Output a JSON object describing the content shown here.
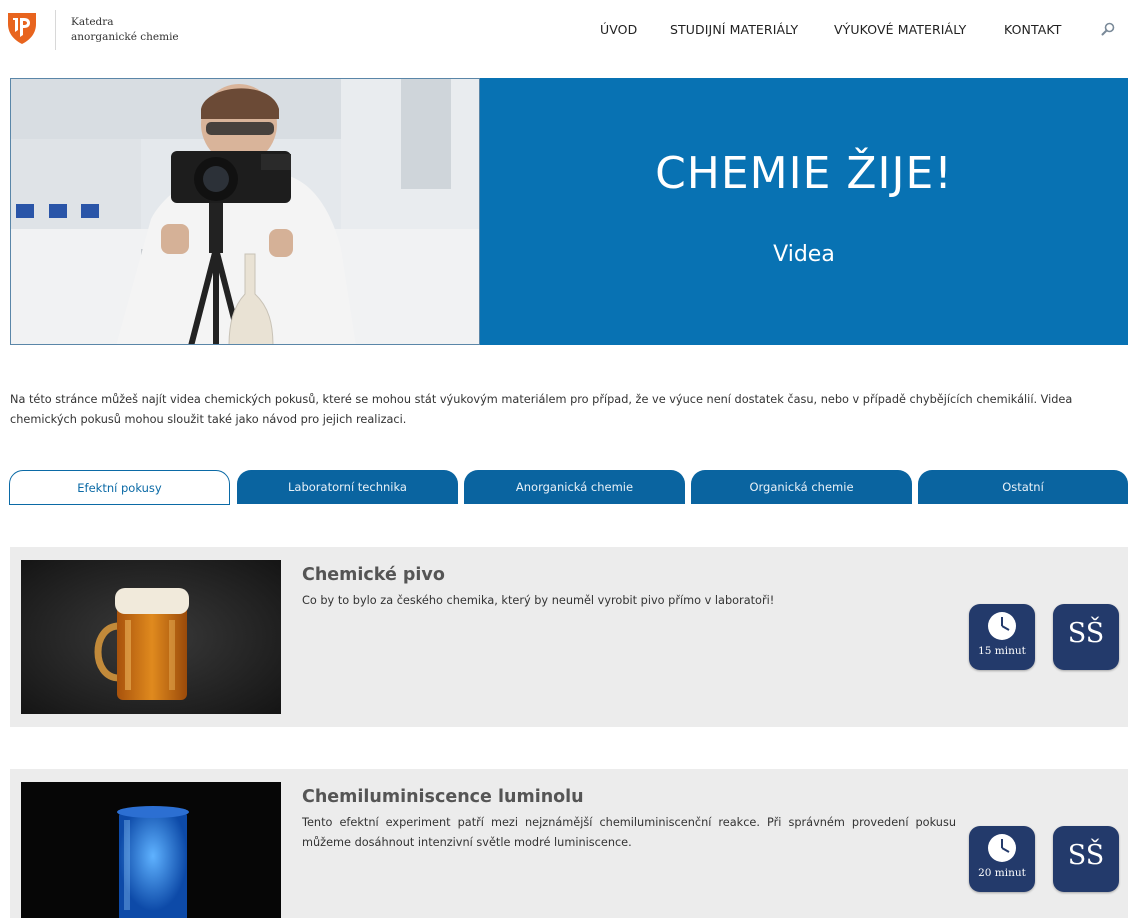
{
  "header": {
    "brand_line1": "Katedra",
    "brand_line2": "anorganické chemie",
    "nav": [
      "ÚVOD",
      "STUDIJNÍ MATERIÁLY",
      "VÝUKOVÉ MATERIÁLY",
      "KONTAKT"
    ]
  },
  "hero": {
    "title": "CHEMIE ŽIJE!",
    "subtitle": "Videa"
  },
  "intro": {
    "line1": "Na této stránce můžeš najít videa chemických pokusů, které se mohou stát výukovým materiálem pro případ, že ve výuce není dostatek času, nebo v případě chybějících chemikálií. Videa",
    "line2": "chemických pokusů mohou sloužit také jako návod pro jejich realizaci."
  },
  "tabs": [
    {
      "label": "Efektní pokusy",
      "active": true
    },
    {
      "label": "Laboratorní technika",
      "active": false
    },
    {
      "label": "Anorganická chemie",
      "active": false
    },
    {
      "label": "Organická chemie",
      "active": false
    },
    {
      "label": "Ostatní",
      "active": false
    }
  ],
  "cards": [
    {
      "title": "Chemické pivo",
      "description": "Co by to bylo za českého chemika, který by neuměl vyrobit pivo přímo v laboratoři!",
      "duration": "15 minut",
      "level": "SŠ"
    },
    {
      "title": "Chemiluminiscence luminolu",
      "description": "Tento efektní experiment patří mezi nejznámější chemiluminiscenční reakce. Při správném provedení pokusu můžeme dosáhnout intenzivní světle modré luminiscence.",
      "duration": "20 minut",
      "level": "SŠ"
    }
  ],
  "colors": {
    "brand_blue": "#0872b3",
    "tab_blue": "#0a64a0",
    "badge_navy": "#233a6b",
    "card_bg": "#ececec",
    "logo_orange": "#e8641e"
  },
  "icons": {
    "logo": "university-logo-icon",
    "search": "search-icon",
    "clock": "clock-icon"
  }
}
